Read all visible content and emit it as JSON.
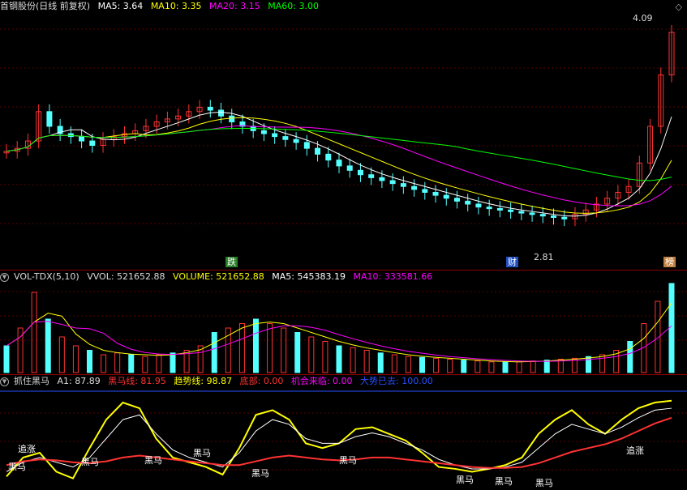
{
  "panel1": {
    "title": "首钢股份(日线 前复权)",
    "ma5": "MA5: 3.64",
    "ma10": "MA10: 3.35",
    "ma20": "MA20: 3.15",
    "ma60": "MA60: 3.00",
    "high_label": "4.09",
    "low_label": "2.81",
    "tag_die": "跌",
    "tag_cai": "财",
    "tag_bang": "榜"
  },
  "panel2": {
    "title": "VOL-TDX(5,10)",
    "vvol": "VVOL: 521652.88",
    "volume": "VOLUME: 521652.88",
    "ma5": "MA5: 545383.19",
    "ma10": "MA10: 333581.66"
  },
  "panel3": {
    "title": "抓住黑马",
    "a1": "A1: 87.89",
    "heima": "黑马线: 81.95",
    "qushi": "趋势线: 98.87",
    "dibu": "底部: 0.00",
    "jihui": "机会来临: 0.00",
    "dashi": "大势已去: 100.00",
    "annotations": [
      "黑马",
      "追涨",
      "黑马",
      "黑马",
      "黑马",
      "黑马",
      "黑马",
      "黑马",
      "黑马",
      "黑马",
      "追涨"
    ]
  },
  "colors": {
    "up": "#ff3232",
    "down": "#54ffff",
    "ma5": "#ffffff",
    "ma10": "#ffff00",
    "ma20": "#ff00ff",
    "ma60": "#00ff00",
    "blue": "#2850ff"
  },
  "chart_data": [
    {
      "type": "candlestick",
      "title": "首钢股份(日线 前复权)",
      "ylim": [
        2.6,
        4.2
      ],
      "close": [
        3.28,
        3.3,
        3.35,
        3.55,
        3.45,
        3.4,
        3.38,
        3.35,
        3.32,
        3.36,
        3.38,
        3.4,
        3.42,
        3.45,
        3.48,
        3.5,
        3.52,
        3.55,
        3.58,
        3.56,
        3.52,
        3.48,
        3.45,
        3.42,
        3.4,
        3.38,
        3.36,
        3.34,
        3.3,
        3.26,
        3.22,
        3.18,
        3.15,
        3.12,
        3.1,
        3.08,
        3.06,
        3.04,
        3.02,
        3.0,
        2.98,
        2.96,
        2.94,
        2.92,
        2.9,
        2.89,
        2.88,
        2.87,
        2.86,
        2.85,
        2.84,
        2.83,
        2.82,
        2.85,
        2.88,
        2.92,
        2.96,
        3.0,
        3.04,
        3.2,
        3.45,
        3.8,
        4.09
      ],
      "high": 4.09,
      "low": 2.81
    },
    {
      "type": "bar",
      "title": "VOL-TDX(5,10)",
      "series_names": [
        "VOLUME",
        "MA5",
        "MA10"
      ],
      "values": [
        0.3,
        0.5,
        0.9,
        0.6,
        0.4,
        0.3,
        0.25,
        0.2,
        0.22,
        0.2,
        0.18,
        0.2,
        0.22,
        0.25,
        0.3,
        0.45,
        0.5,
        0.55,
        0.6,
        0.55,
        0.5,
        0.45,
        0.4,
        0.35,
        0.3,
        0.28,
        0.25,
        0.22,
        0.2,
        0.18,
        0.17,
        0.16,
        0.15,
        0.14,
        0.13,
        0.12,
        0.12,
        0.12,
        0.13,
        0.14,
        0.15,
        0.16,
        0.18,
        0.2,
        0.25,
        0.35,
        0.55,
        0.8,
        1.0
      ],
      "ylim": [
        0,
        1
      ]
    },
    {
      "type": "line",
      "title": "抓住黑马",
      "series": [
        {
          "name": "A1",
          "values": [
            10,
            30,
            35,
            15,
            8,
            40,
            70,
            88,
            82,
            50,
            30,
            25,
            20,
            12,
            40,
            75,
            80,
            70,
            45,
            40,
            45,
            60,
            62,
            55,
            48,
            35,
            20,
            18,
            15,
            18,
            22,
            30,
            55,
            70,
            80,
            65,
            55,
            70,
            82,
            88,
            90
          ]
        },
        {
          "name": "黑马线",
          "values": [
            15,
            25,
            30,
            25,
            20,
            30,
            50,
            70,
            75,
            55,
            38,
            30,
            25,
            20,
            35,
            58,
            70,
            65,
            50,
            45,
            45,
            52,
            56,
            52,
            45,
            38,
            28,
            22,
            18,
            18,
            20,
            25,
            40,
            55,
            65,
            60,
            55,
            62,
            72,
            80,
            82
          ]
        },
        {
          "name": "趋势线",
          "values": [
            22,
            26,
            28,
            27,
            25,
            24,
            26,
            30,
            32,
            30,
            28,
            26,
            24,
            22,
            22,
            26,
            30,
            32,
            30,
            28,
            27,
            28,
            30,
            30,
            28,
            26,
            24,
            22,
            20,
            19,
            19,
            20,
            24,
            30,
            36,
            40,
            44,
            50,
            58,
            66,
            72
          ]
        }
      ],
      "ylim": [
        0,
        100
      ]
    }
  ]
}
